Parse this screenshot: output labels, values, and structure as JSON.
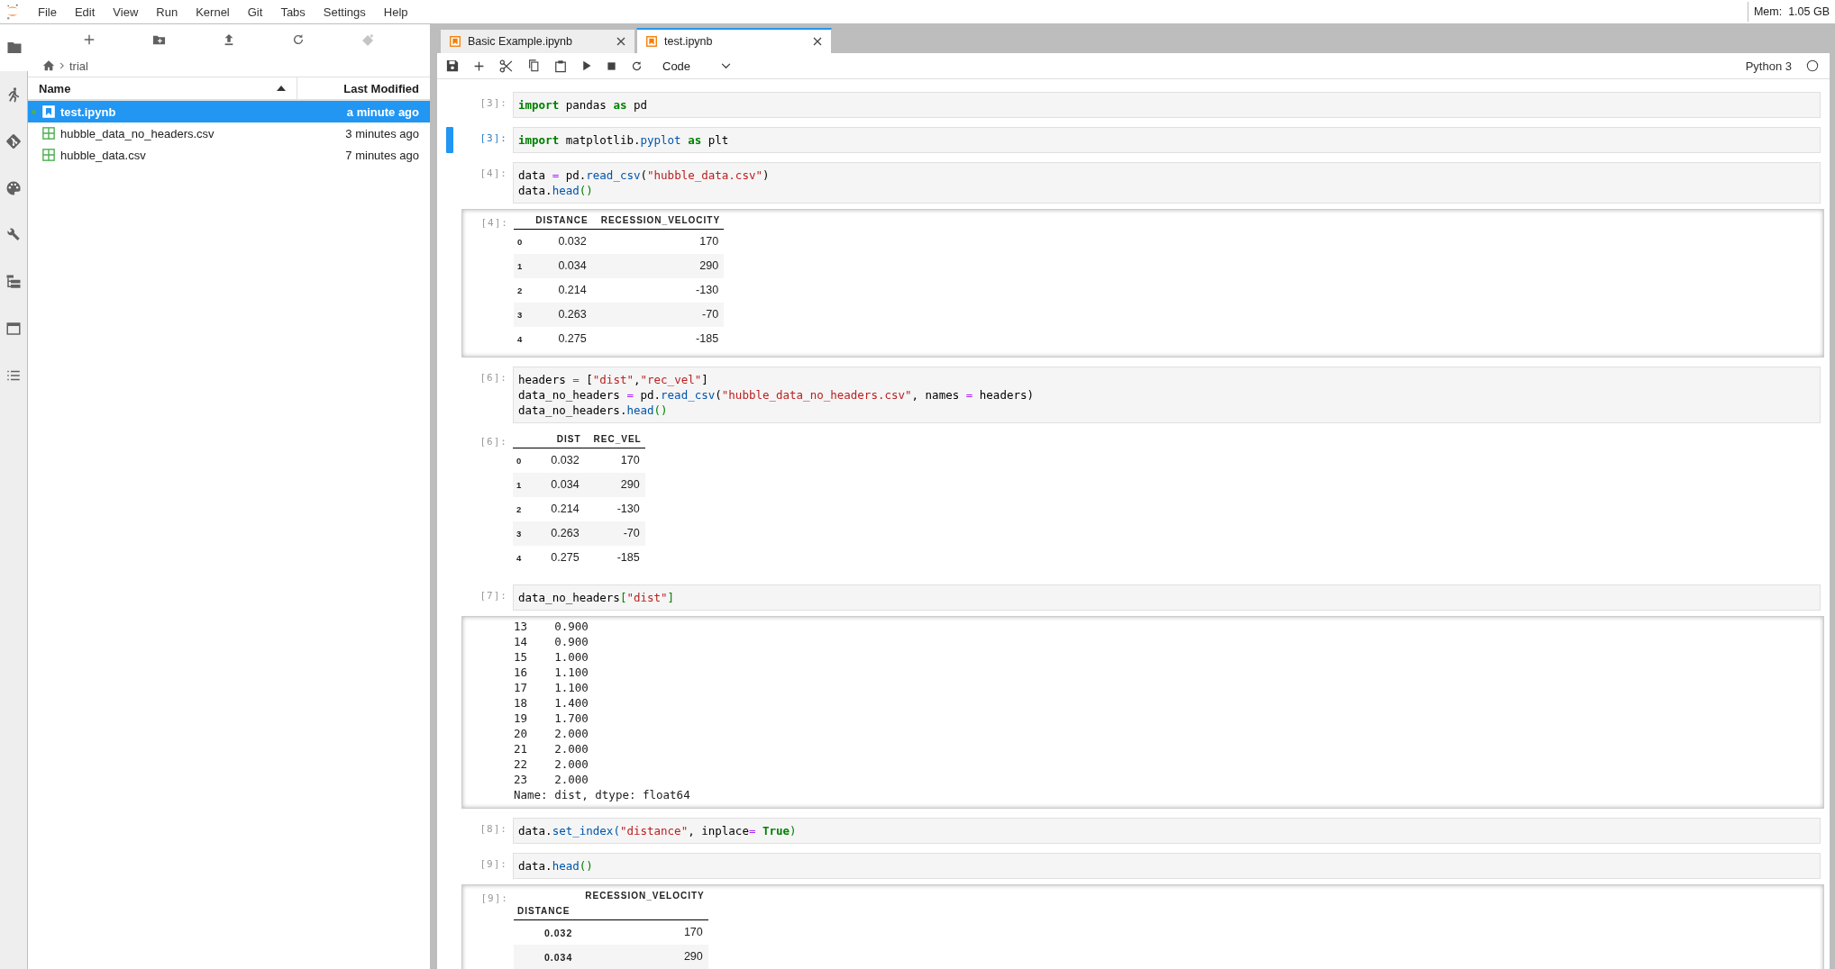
{
  "menu": [
    "File",
    "Edit",
    "View",
    "Run",
    "Kernel",
    "Git",
    "Tabs",
    "Settings",
    "Help"
  ],
  "memory": "Mem:  1.05 GB",
  "activity_bar": [
    {
      "kind": "files",
      "selected": true
    },
    {
      "kind": "running",
      "selected": false
    },
    {
      "kind": "git",
      "selected": false
    },
    {
      "kind": "palette",
      "selected": false
    },
    {
      "kind": "tools",
      "selected": false
    },
    {
      "kind": "tree",
      "selected": false
    },
    {
      "kind": "tabs",
      "selected": false
    },
    {
      "kind": "toc",
      "selected": false
    }
  ],
  "file_browser": {
    "breadcrumb": "trial",
    "columns": [
      "Name",
      "Last Modified"
    ],
    "files": [
      {
        "name": "test.ipynb",
        "modified": "a minute ago",
        "kind": "notebook",
        "selected": true,
        "running": true
      },
      {
        "name": "hubble_data_no_headers.csv",
        "modified": "3 minutes ago",
        "kind": "csv",
        "selected": false,
        "running": false
      },
      {
        "name": "hubble_data.csv",
        "modified": "7 minutes ago",
        "kind": "csv",
        "selected": false,
        "running": false
      }
    ]
  },
  "tabs": [
    {
      "label": "Basic Example.ipynb",
      "selected": false
    },
    {
      "label": "test.ipynb",
      "selected": true
    }
  ],
  "toolbar": {
    "cell_type": "Code",
    "kernel": "Python 3",
    "kernel_busy": false
  },
  "cells": [
    {
      "prompt": "[3]:",
      "active": false,
      "input": [
        [
          {
            "text": "import",
            "kind": "kw"
          },
          {
            "text": " pandas ",
            "kind": "plain"
          },
          {
            "text": "as",
            "kind": "kw"
          },
          {
            "text": " pd",
            "kind": "plain"
          }
        ]
      ]
    },
    {
      "prompt": "[3]:",
      "active": true,
      "input": [
        [
          {
            "text": "import",
            "kind": "kw"
          },
          {
            "text": " matplotlib.",
            "kind": "plain"
          },
          {
            "text": "pyplot ",
            "kind": "attr"
          },
          {
            "text": "as",
            "kind": "kw"
          },
          {
            "text": " plt",
            "kind": "plain"
          }
        ]
      ]
    },
    {
      "prompt": "[4]:",
      "active": false,
      "input": [
        [
          {
            "text": "data ",
            "kind": "plain"
          },
          {
            "text": "=",
            "kind": "op"
          },
          {
            "text": " pd.",
            "kind": "plain"
          },
          {
            "text": "read_csv",
            "kind": "attr"
          },
          {
            "text": "(",
            "kind": "plain"
          },
          {
            "text": "\"hubble_data.csv\"",
            "kind": "str"
          },
          {
            "text": ")",
            "kind": "plain"
          }
        ],
        [
          {
            "text": "data.",
            "kind": "plain"
          },
          {
            "text": "head",
            "kind": "attr"
          },
          {
            "text": "()",
            "kind": "bracket"
          }
        ]
      ],
      "output": {
        "prompt": "[4]:",
        "scrolled": true,
        "kind": "dataframe",
        "columns": [
          "DISTANCE",
          "RECESSION_VELOCITY"
        ],
        "rows": [
          {
            "index": "0",
            "cells": [
              "0.032",
              "170"
            ]
          },
          {
            "index": "1",
            "cells": [
              "0.034",
              "290"
            ]
          },
          {
            "index": "2",
            "cells": [
              "0.214",
              "-130"
            ]
          },
          {
            "index": "3",
            "cells": [
              "0.263",
              "-70"
            ]
          },
          {
            "index": "4",
            "cells": [
              "0.275",
              "-185"
            ]
          }
        ]
      }
    },
    {
      "prompt": "[6]:",
      "active": false,
      "input": [
        [
          {
            "text": "headers ",
            "kind": "plain"
          },
          {
            "text": "=",
            "kind": "op"
          },
          {
            "text": " [",
            "kind": "plain"
          },
          {
            "text": "\"dist\"",
            "kind": "str"
          },
          {
            "text": ",",
            "kind": "plain"
          },
          {
            "text": "\"rec_vel\"",
            "kind": "str"
          },
          {
            "text": "]",
            "kind": "plain"
          }
        ],
        [
          {
            "text": "data_no_headers ",
            "kind": "plain"
          },
          {
            "text": "=",
            "kind": "op"
          },
          {
            "text": " pd.",
            "kind": "plain"
          },
          {
            "text": "read_csv",
            "kind": "attr"
          },
          {
            "text": "(",
            "kind": "plain"
          },
          {
            "text": "\"hubble_data_no_headers.csv\"",
            "kind": "str"
          },
          {
            "text": ", names ",
            "kind": "plain"
          },
          {
            "text": "=",
            "kind": "op"
          },
          {
            "text": " headers)",
            "kind": "plain"
          }
        ],
        [
          {
            "text": "data_no_headers.",
            "kind": "plain"
          },
          {
            "text": "head",
            "kind": "attr"
          },
          {
            "text": "()",
            "kind": "bracket"
          }
        ]
      ],
      "output": {
        "prompt": "[6]:",
        "scrolled": false,
        "kind": "dataframe",
        "columns": [
          "DIST",
          "REC_VEL"
        ],
        "rows": [
          {
            "index": "0",
            "cells": [
              "0.032",
              "170"
            ]
          },
          {
            "index": "1",
            "cells": [
              "0.034",
              "290"
            ]
          },
          {
            "index": "2",
            "cells": [
              "0.214",
              "-130"
            ]
          },
          {
            "index": "3",
            "cells": [
              "0.263",
              "-70"
            ]
          },
          {
            "index": "4",
            "cells": [
              "0.275",
              "-185"
            ]
          }
        ]
      }
    },
    {
      "prompt": "[7]:",
      "active": false,
      "input": [
        [
          {
            "text": "data_no_headers",
            "kind": "plain"
          },
          {
            "text": "[",
            "kind": "bracket"
          },
          {
            "text": "\"dist\"",
            "kind": "str"
          },
          {
            "text": "]",
            "kind": "bracket"
          }
        ]
      ],
      "output": {
        "scrolled": true,
        "kind": "stream",
        "lines": [
          "13    0.900",
          "14    0.900",
          "15    1.000",
          "16    1.100",
          "17    1.100",
          "18    1.400",
          "19    1.700",
          "20    2.000",
          "21    2.000",
          "22    2.000",
          "23    2.000",
          "Name: dist, dtype: float64"
        ]
      }
    },
    {
      "prompt": "[8]:",
      "active": false,
      "input": [
        [
          {
            "text": "data.",
            "kind": "plain"
          },
          {
            "text": "set_index",
            "kind": "attr"
          },
          {
            "text": "(",
            "kind": "attr"
          },
          {
            "text": "\"distance\"",
            "kind": "str"
          },
          {
            "text": ", inplace",
            "kind": "plain"
          },
          {
            "text": "= ",
            "kind": "op"
          },
          {
            "text": "True",
            "kind": "kw"
          },
          {
            "text": ")",
            "kind": "bracket"
          }
        ]
      ]
    },
    {
      "prompt": "[9]:",
      "active": false,
      "input": [
        [
          {
            "text": "data.",
            "kind": "plain"
          },
          {
            "text": "head",
            "kind": "attr"
          },
          {
            "text": "()",
            "kind": "bracket"
          }
        ]
      ],
      "output": {
        "prompt": "[9]:",
        "scrolled": true,
        "kind": "dataframe",
        "index_name": "DISTANCE",
        "columns": [
          "RECESSION_VELOCITY"
        ],
        "rows": [
          {
            "index": "0.032",
            "cells": [
              "170"
            ]
          },
          {
            "index": "0.034",
            "cells": [
              "290"
            ]
          }
        ]
      }
    }
  ]
}
